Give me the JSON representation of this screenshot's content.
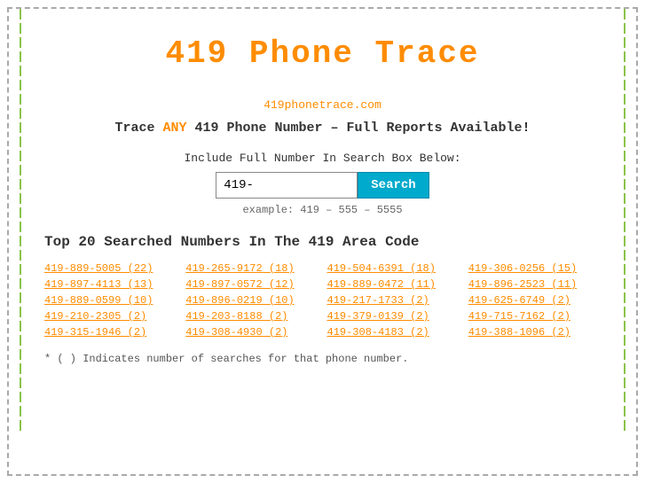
{
  "title": "419 Phone Trace",
  "site_url": "419phonetrace.com",
  "tagline_before": "Trace ",
  "tagline_any": "ANY",
  "tagline_after": " 419 Phone Number – Full Reports Available!",
  "search": {
    "label": "Include Full Number In Search Box Below:",
    "placeholder": "419-",
    "button_label": "Search",
    "example": "example: 419 – 555 – 5555"
  },
  "top_numbers_title": "Top 20 Searched Numbers In The 419 Area Code",
  "numbers": [
    {
      "text": "419-889-5005 (22)"
    },
    {
      "text": "419-265-9172 (18)"
    },
    {
      "text": "419-504-6391 (18)"
    },
    {
      "text": "419-306-0256 (15)"
    },
    {
      "text": "419-897-4113 (13)"
    },
    {
      "text": "419-897-0572 (12)"
    },
    {
      "text": "419-889-0472 (11)"
    },
    {
      "text": "419-896-2523 (11)"
    },
    {
      "text": "419-889-0599 (10)"
    },
    {
      "text": "419-896-0219 (10)"
    },
    {
      "text": "419-217-1733 (2)"
    },
    {
      "text": "419-625-6749 (2)"
    },
    {
      "text": "419-210-2305 (2)"
    },
    {
      "text": "419-203-8188 (2)"
    },
    {
      "text": "419-379-0139 (2)"
    },
    {
      "text": "419-715-7162 (2)"
    },
    {
      "text": "419-315-1946 (2)"
    },
    {
      "text": "419-308-4930 (2)"
    },
    {
      "text": "419-308-4183 (2)"
    },
    {
      "text": "419-388-1096 (2)"
    }
  ],
  "footnote": "* ( ) Indicates number of searches for that phone number."
}
